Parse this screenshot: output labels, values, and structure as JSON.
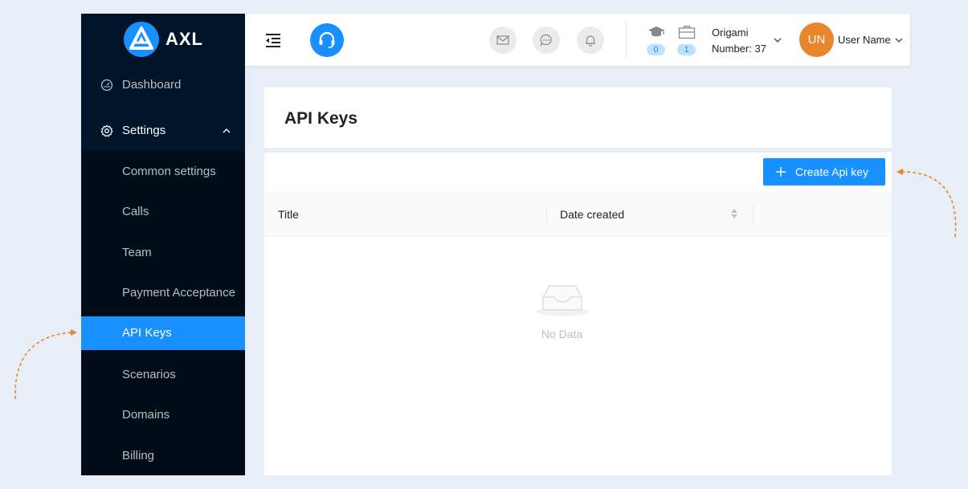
{
  "app": {
    "logo_text": "AXL",
    "accent_color": "#1890ff",
    "sidebar_color": "#001529"
  },
  "sidebar": {
    "dashboard_label": "Dashboard",
    "settings_label": "Settings",
    "submenu": [
      {
        "label": "Common settings",
        "active": false
      },
      {
        "label": "Calls",
        "active": false
      },
      {
        "label": "Team",
        "active": false
      },
      {
        "label": "Payment Acceptance",
        "active": false
      },
      {
        "label": "API Keys",
        "active": true
      },
      {
        "label": "Scenarios",
        "active": false
      },
      {
        "label": "Domains",
        "active": false
      },
      {
        "label": "Billing",
        "active": false
      }
    ]
  },
  "header": {
    "icons": [
      "menu-fold-icon",
      "headset-icon",
      "mail-icon",
      "chat-icon",
      "bell-icon",
      "graduation-cap-icon",
      "briefcase-icon"
    ],
    "education_count": "0",
    "briefcase_count": "1",
    "origami_line1": "Origami",
    "origami_line2": "Number: 37",
    "avatar_initials": "UN",
    "avatar_color": "#e8862c",
    "user_name": "User Name"
  },
  "main": {
    "page_title": "API Keys",
    "create_button_label": "Create Api key",
    "table": {
      "columns": [
        "Title",
        "Date created"
      ],
      "rows": [],
      "empty_text": "No Data"
    }
  },
  "annotations": {
    "arrow_color": "#e8862c"
  }
}
